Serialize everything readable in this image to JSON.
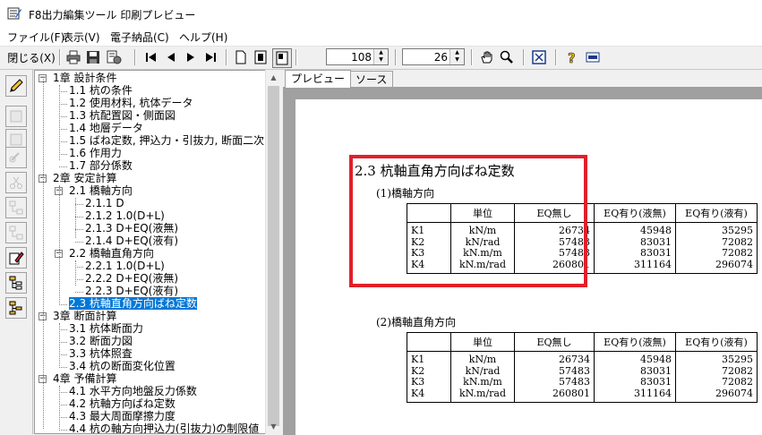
{
  "window": {
    "title": "F8出力編集ツール 印刷プレビュー"
  },
  "menu": [
    "ファイル(F)",
    "表示(V)",
    "電子納品(C)",
    "ヘルプ(H)"
  ],
  "toolbar": {
    "close_label": "閉じる(X)",
    "page_value": "108",
    "zoom_value": "26"
  },
  "tree": [
    {
      "label": "1章 設計条件",
      "expander": "−"
    },
    {
      "label": "1.1 杭の条件"
    },
    {
      "label": "1.2 使用材料, 杭体データ"
    },
    {
      "label": "1.3 杭配置図・側面図"
    },
    {
      "label": "1.4 地層データ"
    },
    {
      "label": "1.5 ばね定数, 押込力・引抜力, 断面二次"
    },
    {
      "label": "1.6 作用力"
    },
    {
      "label": "1.7 部分係数"
    },
    {
      "label": "2章 安定計算",
      "expander": "−"
    },
    {
      "label": "2.1 橋軸方向",
      "expander": "−"
    },
    {
      "label": "2.1.1 D"
    },
    {
      "label": "2.1.2 1.0(D+L)"
    },
    {
      "label": "2.1.3 D+EQ(液無)"
    },
    {
      "label": "2.1.4 D+EQ(液有)"
    },
    {
      "label": "2.2 橋軸直角方向",
      "expander": "−"
    },
    {
      "label": "2.2.1 1.0(D+L)"
    },
    {
      "label": "2.2.2 D+EQ(液無)"
    },
    {
      "label": "2.2.3 D+EQ(液有)"
    },
    {
      "label": "2.3 杭軸直角方向ばね定数"
    },
    {
      "label": "3章 断面計算",
      "expander": "−"
    },
    {
      "label": "3.1 杭体断面力"
    },
    {
      "label": "3.2 断面力図"
    },
    {
      "label": "3.3 杭体照査"
    },
    {
      "label": "3.4 杭の断面変化位置"
    },
    {
      "label": "4章 予備計算",
      "expander": "−"
    },
    {
      "label": "4.1 水平方向地盤反力係数"
    },
    {
      "label": "4.2 杭軸方向ばね定数"
    },
    {
      "label": "4.3 最大周面摩擦力度"
    },
    {
      "label": "4.4 杭の軸方向押込力(引抜力)の制限値"
    }
  ],
  "tabs": [
    "プレビュー",
    "ソース"
  ],
  "document": {
    "heading": "2.3 杭軸直角方向ばね定数",
    "sections": [
      {
        "subheading": "(1)橋軸方向",
        "headers": [
          "",
          "単位",
          "EQ無し",
          "EQ有り(液無)",
          "EQ有り(液有)"
        ],
        "rows": [
          [
            "K1",
            "kN/m",
            "26734",
            "45948",
            "35295"
          ],
          [
            "K2",
            "kN/rad",
            "57483",
            "83031",
            "72082"
          ],
          [
            "K3",
            "kN.m/m",
            "57483",
            "83031",
            "72082"
          ],
          [
            "K4",
            "kN.m/rad",
            "260801",
            "311164",
            "296074"
          ]
        ]
      },
      {
        "subheading": "(2)橋軸直角方向",
        "headers": [
          "",
          "単位",
          "EQ無し",
          "EQ有り(液無)",
          "EQ有り(液有)"
        ],
        "rows": [
          [
            "K1",
            "kN/m",
            "26734",
            "45948",
            "35295"
          ],
          [
            "K2",
            "kN/rad",
            "57483",
            "83031",
            "72082"
          ],
          [
            "K3",
            "kN.m/m",
            "57483",
            "83031",
            "72082"
          ],
          [
            "K4",
            "kN.m/rad",
            "260801",
            "311164",
            "296074"
          ]
        ]
      }
    ]
  },
  "colors": {
    "selection": "#0078d7",
    "highlight_box": "#e0202a"
  }
}
